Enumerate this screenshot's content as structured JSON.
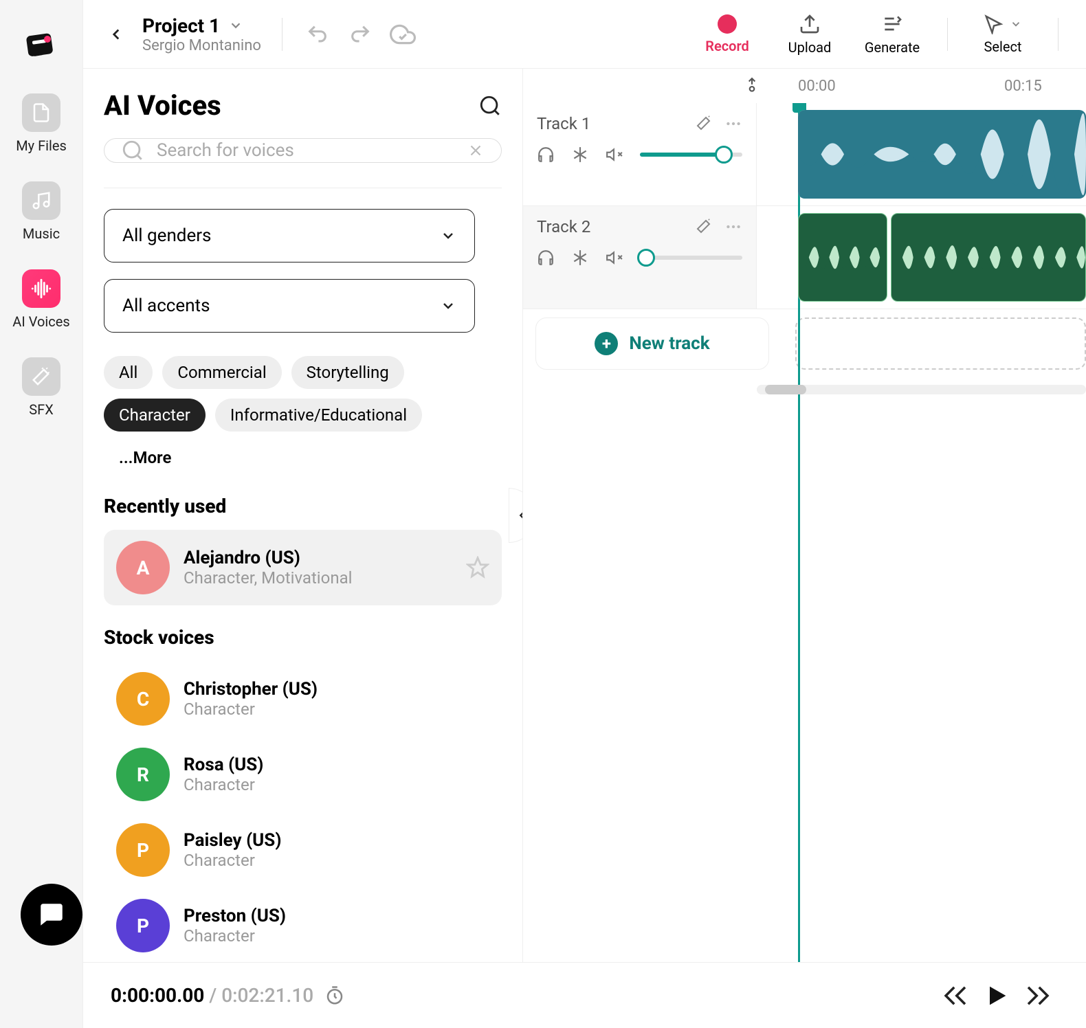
{
  "header": {
    "project_title": "Project 1",
    "owner": "Sergio Montanino",
    "actions": {
      "record": "Record",
      "upload": "Upload",
      "generate": "Generate",
      "select": "Select"
    }
  },
  "vnav": {
    "my_files": "My Files",
    "music": "Music",
    "ai_voices": "AI Voices",
    "sfx": "SFX"
  },
  "voices_panel": {
    "title": "AI Voices",
    "search_placeholder": "Search for voices",
    "filters": {
      "gender": "All genders",
      "accent": "All accents"
    },
    "chips": [
      "All",
      "Commercial",
      "Storytelling",
      "Character",
      "Informative/Educational"
    ],
    "chip_more": "...More",
    "active_chip_index": 3,
    "recently_used_title": "Recently used",
    "stock_title": "Stock voices",
    "recent": [
      {
        "initial": "A",
        "name": "Alejandro (US)",
        "tags": "Character, Motivational",
        "color": "#f08c8c"
      }
    ],
    "stock": [
      {
        "initial": "C",
        "name": "Christopher (US)",
        "tags": "Character",
        "color": "#f0a020"
      },
      {
        "initial": "R",
        "name": "Rosa (US)",
        "tags": "Character",
        "color": "#2fa84f"
      },
      {
        "initial": "P",
        "name": "Paisley (US)",
        "tags": "Character",
        "color": "#f0a020"
      },
      {
        "initial": "P",
        "name": "Preston (US)",
        "tags": "Character",
        "color": "#5a3fd6"
      }
    ]
  },
  "timeline": {
    "ticks": [
      "00:00",
      "00:15"
    ],
    "tracks": [
      {
        "name": "Track 1",
        "volume_pct": 82
      },
      {
        "name": "Track 2",
        "volume_pct": 6
      }
    ],
    "new_track_label": "New track"
  },
  "transport": {
    "current": "0:00:00.00",
    "sep": " / ",
    "total": "0:02:21.10"
  }
}
